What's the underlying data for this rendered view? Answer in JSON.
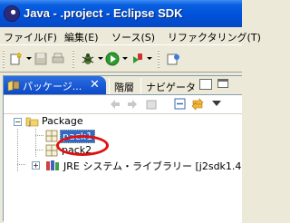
{
  "window": {
    "title": "Java - .project - Eclipse SDK"
  },
  "menubar": {
    "items": [
      "ファイル(F)",
      "編集(E)",
      "ソース(S)",
      "リファクタリング(T)"
    ]
  },
  "toolbar": {
    "icons": [
      "new-icon",
      "save-icon",
      "print-icon",
      "debug-icon",
      "run-icon",
      "external-tools-icon",
      "open-type-icon"
    ]
  },
  "views": {
    "tabs": [
      {
        "label": "パッケージ...",
        "active": true
      },
      {
        "label": "階層",
        "active": false
      },
      {
        "label": "ナビゲータ...",
        "active": false
      }
    ],
    "close_glyph": "✕"
  },
  "tree": {
    "project": "Package",
    "packages": [
      "pack1",
      "pack2"
    ],
    "selected": "pack1",
    "library": "JRE システム・ライブラリー [j2sdk1.4"
  },
  "colors": {
    "title_bar": "#0052d9",
    "active_tab": "#0a47c8",
    "selection": "#316ac5",
    "annotation_ellipse": "#e01010"
  }
}
